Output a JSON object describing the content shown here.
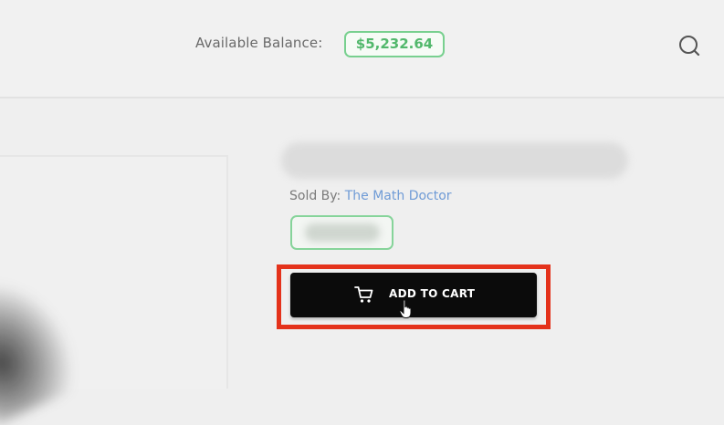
{
  "header": {
    "balance_label": "Available Balance:",
    "balance_value": "$5,232.64",
    "search_icon": "search-icon"
  },
  "product": {
    "sold_by_label": "Sold By:",
    "seller_name": "The Math Doctor",
    "add_to_cart_label": "ADD TO CART",
    "cart_icon": "cart-icon"
  },
  "colors": {
    "accent_green": "#52b86c",
    "link_blue": "#6f9bd6",
    "highlight_red": "#e4321b",
    "button_black": "#0b0b0b"
  }
}
